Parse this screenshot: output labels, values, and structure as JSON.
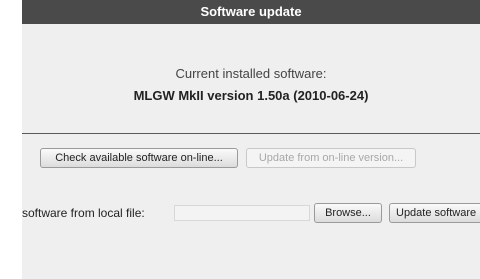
{
  "title": "Software update",
  "current_label": "Current installed software:",
  "current_version": "MLGW MkII version 1.50a (2010-06-24)",
  "buttons": {
    "check_online": "Check available software on-line...",
    "update_online": "Update from on-line version...",
    "browse": "Browse...",
    "update_software": "Update software"
  },
  "local_file_label": "software from local file:",
  "local_file_value": ""
}
